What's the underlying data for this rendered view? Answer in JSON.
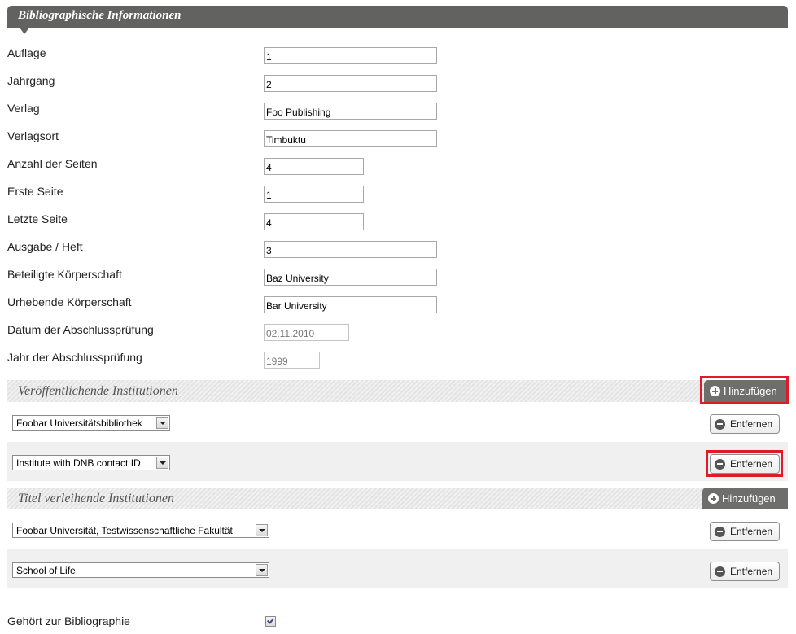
{
  "header": {
    "title": "Bibliographische Informationen"
  },
  "fields": {
    "auflage": {
      "label": "Auflage",
      "value": "1"
    },
    "jahrgang": {
      "label": "Jahrgang",
      "value": "2"
    },
    "verlag": {
      "label": "Verlag",
      "value": "Foo Publishing"
    },
    "verlagsort": {
      "label": "Verlagsort",
      "value": "Timbuktu"
    },
    "seiten": {
      "label": "Anzahl der Seiten",
      "value": "4"
    },
    "erste_seite": {
      "label": "Erste Seite",
      "value": "1"
    },
    "letzte_seite": {
      "label": "Letzte Seite",
      "value": "4"
    },
    "ausgabe": {
      "label": "Ausgabe / Heft",
      "value": "3"
    },
    "beteiligte": {
      "label": "Beteiligte Körperschaft",
      "value": "Baz University"
    },
    "urhebende": {
      "label": "Urhebende Körperschaft",
      "value": "Bar University"
    },
    "datum": {
      "label": "Datum der Abschlussprüfung",
      "value": "02.11.2010"
    },
    "jahr": {
      "label": "Jahr der Abschlussprüfung",
      "value": "1999"
    }
  },
  "publishing": {
    "title": "Veröffentlichende Institutionen",
    "add_label": "Hinzufügen",
    "rows": [
      {
        "selected": "Foobar Universitätsbibliothek",
        "remove_label": "Entfernen"
      },
      {
        "selected": "Institute with DNB contact ID",
        "remove_label": "Entfernen"
      }
    ]
  },
  "granting": {
    "title": "Titel verleihende Institutionen",
    "add_label": "Hinzufügen",
    "rows": [
      {
        "selected": "Foobar Universität, Testwissenschaftliche Fakultät",
        "remove_label": "Entfernen"
      },
      {
        "selected": "School of Life",
        "remove_label": "Entfernen"
      }
    ]
  },
  "bibliography": {
    "label": "Gehört zur Bibliographie",
    "checked": true
  },
  "colors": {
    "header_bg": "#626260",
    "highlight": "#e0192b",
    "add_button_bg": "#6e6e6c"
  },
  "icons": {
    "add": "plus-circle-icon",
    "remove": "minus-circle-icon",
    "dropdown": "chevron-down-icon"
  }
}
